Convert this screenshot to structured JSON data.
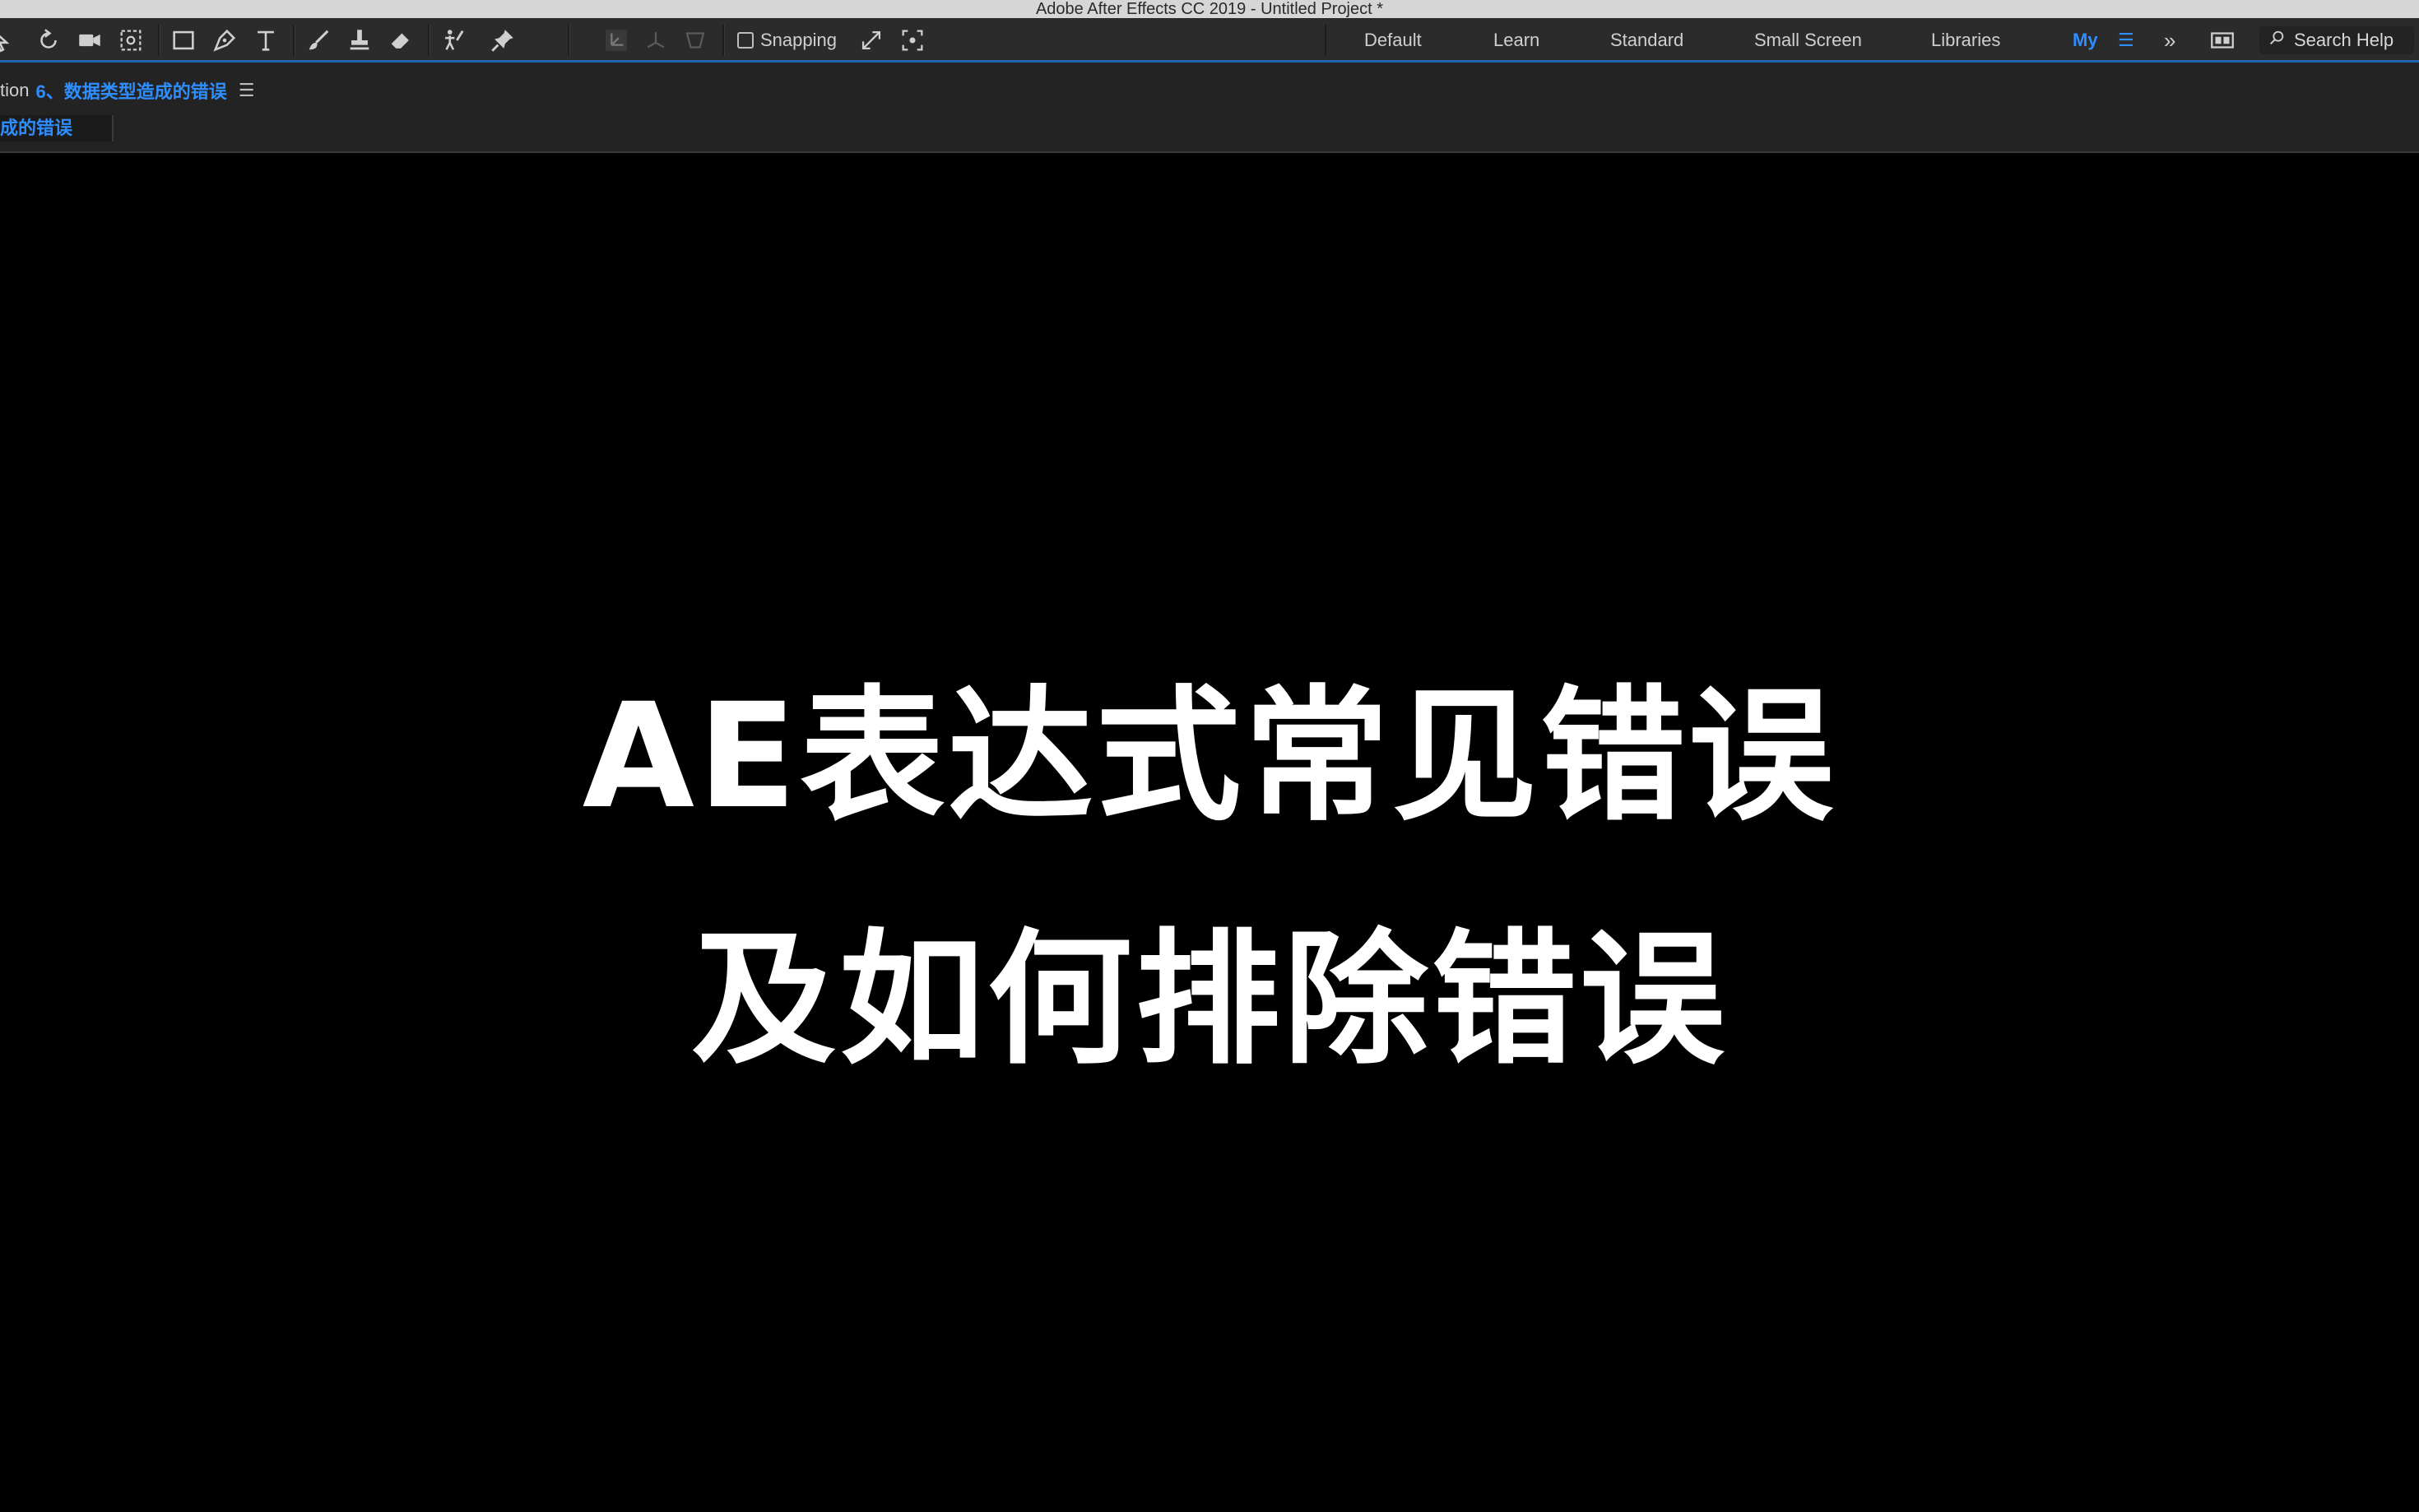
{
  "window": {
    "title": "Adobe After Effects CC 2019 - Untitled Project *"
  },
  "toolbar": {
    "tools": [
      {
        "icon": "selection-icon"
      },
      {
        "icon": "rotate-icon"
      },
      {
        "icon": "camera-icon"
      },
      {
        "icon": "pan-behind-icon"
      },
      {
        "icon": "rectangle-icon"
      },
      {
        "icon": "pen-icon"
      },
      {
        "icon": "type-icon"
      },
      {
        "icon": "brush-icon"
      },
      {
        "icon": "clone-stamp-icon"
      },
      {
        "icon": "eraser-icon"
      },
      {
        "icon": "roto-brush-icon"
      },
      {
        "icon": "puppet-pin-icon"
      }
    ],
    "axis_tools": [
      {
        "icon": "local-axis-icon",
        "enabled": false
      },
      {
        "icon": "world-axis-icon",
        "enabled": false
      },
      {
        "icon": "view-axis-icon",
        "enabled": false
      }
    ],
    "snapping": {
      "label": "Snapping",
      "checked": false
    },
    "workspaces": [
      "Default",
      "Learn",
      "Standard",
      "Small Screen",
      "Libraries",
      "My"
    ],
    "active_workspace": "My",
    "search": {
      "placeholder": "Search Help"
    }
  },
  "panel": {
    "tab_prefix": "tion",
    "tab_name": "6、数据类型造成的错误",
    "comp_chip": "成的错误"
  },
  "viewer": {
    "line1": "AE表达式常见错误",
    "line2": "及如何排除错误"
  },
  "colors": {
    "accent": "#2f8eff",
    "toolbar_bg": "#2b2b2b",
    "panel_bg": "#232323",
    "viewer_bg": "#000000",
    "title_text": "#ffffff"
  }
}
